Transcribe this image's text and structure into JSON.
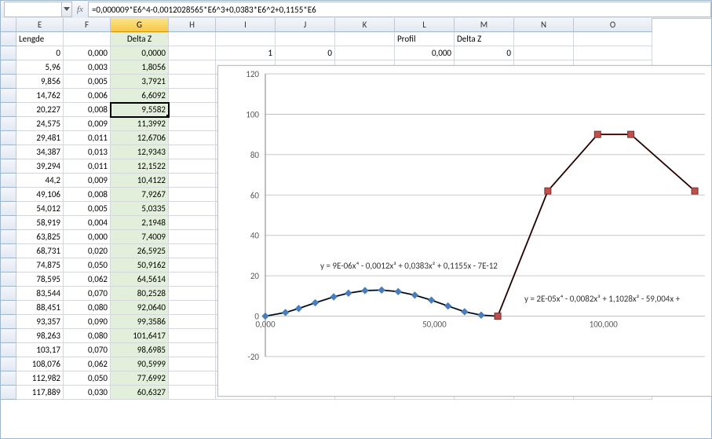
{
  "formula_bar": {
    "name_box": "",
    "fx_label": "fx",
    "formula": "=0,000009*E6^4-0,0012028565*E6^3+0,0383*E6^2+0,1155*E6"
  },
  "col_headers": [
    "E",
    "F",
    "G",
    "H",
    "I",
    "J",
    "K",
    "L",
    "M",
    "N",
    "O"
  ],
  "row1": {
    "E": "Lengde",
    "G": "Delta Z",
    "L": "Profil",
    "M": "Delta Z"
  },
  "row2": {
    "I": "1",
    "J": "0",
    "L": "0,000",
    "M": "0"
  },
  "data_rows": [
    {
      "E": "0",
      "F": "0,000",
      "G": "0,0000"
    },
    {
      "E": "5,96",
      "F": "0,003",
      "G": "1,8056"
    },
    {
      "E": "9,856",
      "F": "0,005",
      "G": "3,7921"
    },
    {
      "E": "14,762",
      "F": "0,006",
      "G": "6,6092"
    },
    {
      "E": "20,227",
      "F": "0,008",
      "G": "9,5582",
      "active": true
    },
    {
      "E": "24,575",
      "F": "0,009",
      "G": "11,3992"
    },
    {
      "E": "29,481",
      "F": "0,011",
      "G": "12,6706"
    },
    {
      "E": "34,387",
      "F": "0,013",
      "G": "12,9343"
    },
    {
      "E": "39,294",
      "F": "0,011",
      "G": "12,1522"
    },
    {
      "E": "44,2",
      "F": "0,009",
      "G": "10,4122"
    },
    {
      "E": "49,106",
      "F": "0,008",
      "G": "7,9267"
    },
    {
      "E": "54,012",
      "F": "0,005",
      "G": "5,0335"
    },
    {
      "E": "58,919",
      "F": "0,004",
      "G": "2,1948"
    },
    {
      "E": "63,825",
      "F": "0,000",
      "G": "7,4009"
    },
    {
      "E": "68,731",
      "F": "0,020",
      "G": "26,5925"
    },
    {
      "E": "74,875",
      "F": "0,050",
      "G": "50,9162"
    },
    {
      "E": "78,595",
      "F": "0,062",
      "G": "64,5614"
    },
    {
      "E": "83,544",
      "F": "0,070",
      "G": "80,2528"
    },
    {
      "E": "88,451",
      "F": "0,080",
      "G": "92,0640"
    },
    {
      "E": "93,357",
      "F": "0,090",
      "G": "99,3586"
    },
    {
      "E": "98,263",
      "F": "0,080",
      "G": "101,6417"
    },
    {
      "E": "103,17",
      "F": "0,070",
      "G": "98,6985"
    },
    {
      "E": "108,076",
      "F": "0,062",
      "G": "90,5999"
    },
    {
      "E": "112,982",
      "F": "0,050",
      "G": "77,6992"
    },
    {
      "E": "117,889",
      "F": "0,030",
      "G": "60,6327"
    }
  ],
  "chart_data": {
    "type": "scatter",
    "xlabel": "",
    "ylabel": "",
    "xlim": [
      0,
      130
    ],
    "ylim": [
      -20,
      120
    ],
    "x_ticks": [
      {
        "v": 0,
        "label": "0,000"
      },
      {
        "v": 50,
        "label": "50,000"
      },
      {
        "v": 100,
        "label": "100,000"
      }
    ],
    "y_ticks": [
      -20,
      0,
      20,
      40,
      60,
      80,
      100,
      120
    ],
    "series": [
      {
        "name": "blue",
        "color": "#4a7ebb",
        "trend_color": "#000",
        "equation": "y = 9E-06x⁴ - 0,0012x³ + 0,0383x² + 0,1155x - 7E-12",
        "points": [
          {
            "x": 0,
            "y": 0
          },
          {
            "x": 5.96,
            "y": 1.81
          },
          {
            "x": 9.86,
            "y": 3.79
          },
          {
            "x": 14.76,
            "y": 6.61
          },
          {
            "x": 20.23,
            "y": 9.56
          },
          {
            "x": 24.58,
            "y": 11.4
          },
          {
            "x": 29.48,
            "y": 12.67
          },
          {
            "x": 34.39,
            "y": 12.93
          },
          {
            "x": 39.29,
            "y": 12.15
          },
          {
            "x": 44.2,
            "y": 10.41
          },
          {
            "x": 49.11,
            "y": 7.93
          },
          {
            "x": 54.01,
            "y": 5.03
          },
          {
            "x": 58.92,
            "y": 2.19
          },
          {
            "x": 63.83,
            "y": 0.5
          },
          {
            "x": 68.73,
            "y": 0
          }
        ]
      },
      {
        "name": "red",
        "color": "#c0504d",
        "trend_color": "#000",
        "equation": "y = 2E-05x⁴ - 0,0082x³ + 1,1028x² - 59,004x +",
        "points": [
          {
            "x": 68.73,
            "y": 0
          },
          {
            "x": 83.54,
            "y": 62
          },
          {
            "x": 98.26,
            "y": 90
          },
          {
            "x": 108.08,
            "y": 90
          },
          {
            "x": 127,
            "y": 62
          }
        ]
      }
    ]
  }
}
